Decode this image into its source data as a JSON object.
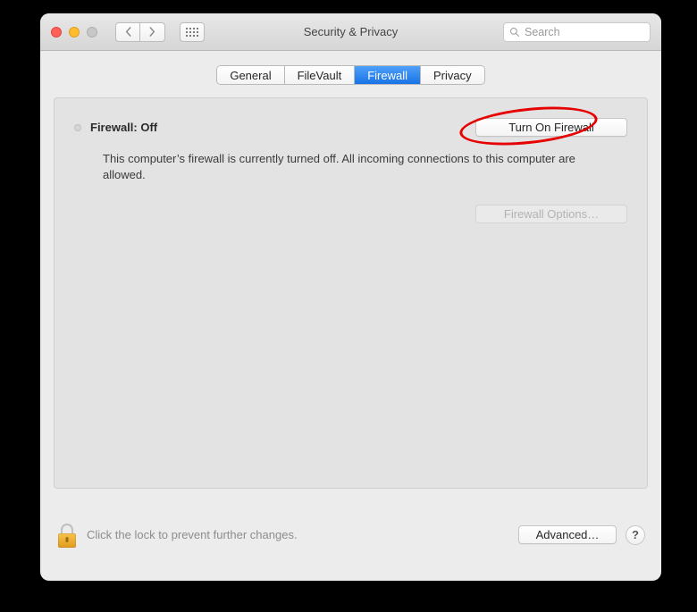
{
  "window": {
    "title": "Security & Privacy",
    "search_placeholder": "Search"
  },
  "tabs": [
    {
      "label": "General",
      "active": false
    },
    {
      "label": "FileVault",
      "active": false
    },
    {
      "label": "Firewall",
      "active": true
    },
    {
      "label": "Privacy",
      "active": false
    }
  ],
  "firewall": {
    "status_label": "Firewall: Off",
    "turn_on_label": "Turn On Firewall",
    "description": "This computer’s firewall is currently turned off. All incoming connections to this computer are allowed.",
    "options_label": "Firewall Options…"
  },
  "footer": {
    "lock_hint": "Click the lock to prevent further changes.",
    "advanced_label": "Advanced…",
    "help_label": "?"
  },
  "annotation": {
    "target": "turn-on-firewall-button",
    "color": "#e60000"
  }
}
